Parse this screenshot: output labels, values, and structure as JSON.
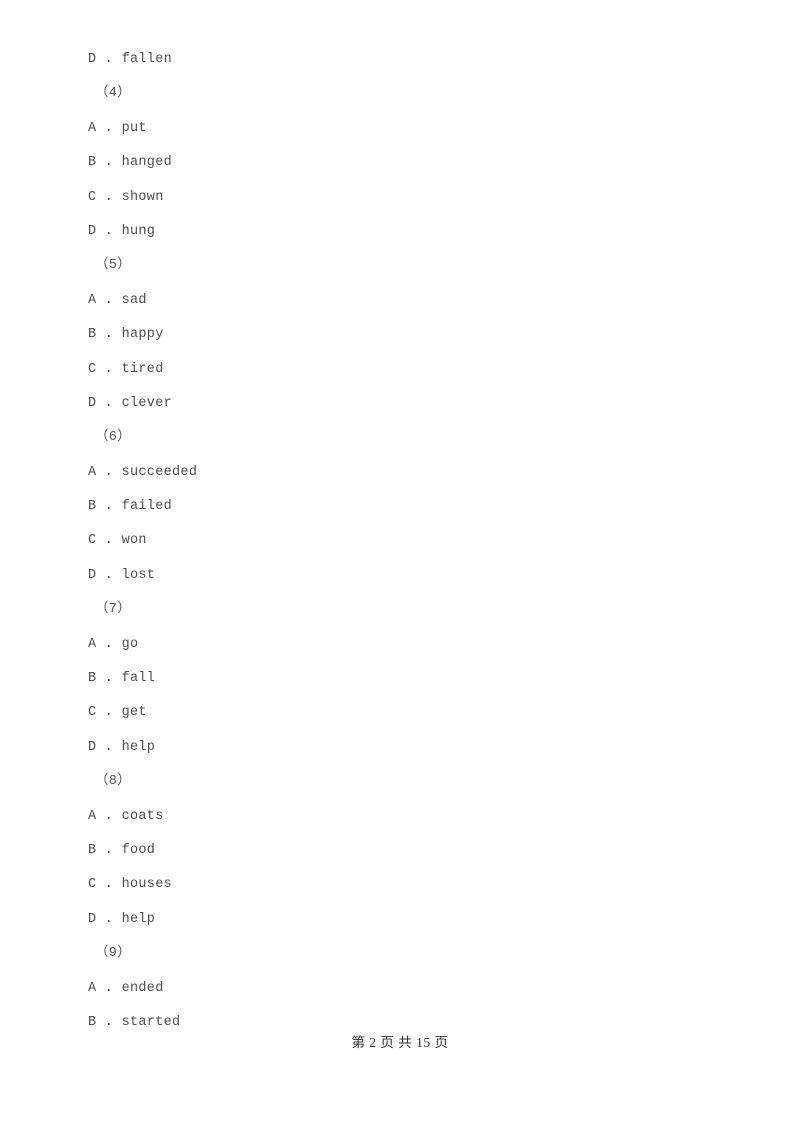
{
  "document": {
    "type": "exam-paper",
    "page_background": "#ffffff",
    "text_color": "#4d4d4d",
    "footer_color": "#2e2e2e"
  },
  "body_lines": [
    {
      "kind": "option",
      "text": "D . fallen"
    },
    {
      "kind": "group",
      "text": "（4）"
    },
    {
      "kind": "option",
      "text": "A . put"
    },
    {
      "kind": "option",
      "text": "B . hanged"
    },
    {
      "kind": "option",
      "text": "C . shown"
    },
    {
      "kind": "option",
      "text": "D . hung"
    },
    {
      "kind": "group",
      "text": "（5）"
    },
    {
      "kind": "option",
      "text": "A . sad"
    },
    {
      "kind": "option",
      "text": "B . happy"
    },
    {
      "kind": "option",
      "text": "C . tired"
    },
    {
      "kind": "option",
      "text": "D . clever"
    },
    {
      "kind": "group",
      "text": "（6）"
    },
    {
      "kind": "option",
      "text": "A . succeeded"
    },
    {
      "kind": "option",
      "text": "B . failed"
    },
    {
      "kind": "option",
      "text": "C . won"
    },
    {
      "kind": "option",
      "text": "D . lost"
    },
    {
      "kind": "group",
      "text": "（7）"
    },
    {
      "kind": "option",
      "text": "A . go"
    },
    {
      "kind": "option",
      "text": "B . fall"
    },
    {
      "kind": "option",
      "text": "C . get"
    },
    {
      "kind": "option",
      "text": "D . help"
    },
    {
      "kind": "group",
      "text": "（8）"
    },
    {
      "kind": "option",
      "text": "A . coats"
    },
    {
      "kind": "option",
      "text": "B . food"
    },
    {
      "kind": "option",
      "text": "C . houses"
    },
    {
      "kind": "option",
      "text": "D . help"
    },
    {
      "kind": "group",
      "text": "（9）"
    },
    {
      "kind": "option",
      "text": "A . ended"
    },
    {
      "kind": "option",
      "text": "B . started"
    }
  ],
  "question_groups": [
    {
      "number": "（4）",
      "options": [
        {
          "letter": "A",
          "text": "put"
        },
        {
          "letter": "B",
          "text": "hanged"
        },
        {
          "letter": "C",
          "text": "shown"
        },
        {
          "letter": "D",
          "text": "hung"
        }
      ]
    },
    {
      "number": "（5）",
      "options": [
        {
          "letter": "A",
          "text": "sad"
        },
        {
          "letter": "B",
          "text": "happy"
        },
        {
          "letter": "C",
          "text": "tired"
        },
        {
          "letter": "D",
          "text": "clever"
        }
      ]
    },
    {
      "number": "（6）",
      "options": [
        {
          "letter": "A",
          "text": "succeeded"
        },
        {
          "letter": "B",
          "text": "failed"
        },
        {
          "letter": "C",
          "text": "won"
        },
        {
          "letter": "D",
          "text": "lost"
        }
      ]
    },
    {
      "number": "（7）",
      "options": [
        {
          "letter": "A",
          "text": "go"
        },
        {
          "letter": "B",
          "text": "fall"
        },
        {
          "letter": "C",
          "text": "get"
        },
        {
          "letter": "D",
          "text": "help"
        }
      ]
    },
    {
      "number": "（8）",
      "options": [
        {
          "letter": "A",
          "text": "coats"
        },
        {
          "letter": "B",
          "text": "food"
        },
        {
          "letter": "C",
          "text": "houses"
        },
        {
          "letter": "D",
          "text": "help"
        }
      ]
    },
    {
      "number": "（9）",
      "options": [
        {
          "letter": "A",
          "text": "ended"
        },
        {
          "letter": "B",
          "text": "started"
        }
      ]
    }
  ],
  "footer": {
    "text": "第 2 页 共 15 页",
    "current_page": "2",
    "total_pages": "15"
  }
}
